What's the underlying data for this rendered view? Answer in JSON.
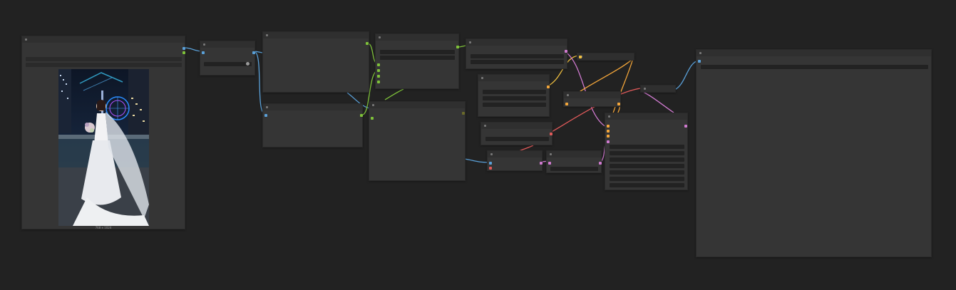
{
  "canvas": {
    "background": "#222222"
  },
  "load_image": {
    "caption": "768 x 1024"
  },
  "port_colors": {
    "image": "#5aa0d8",
    "mask": "#7ec13a",
    "latent": "#f4a63a",
    "conditioning": "#f0a040",
    "vae": "#e05a5a",
    "pink": "#d07ad0",
    "green": "#6fbf3f"
  }
}
